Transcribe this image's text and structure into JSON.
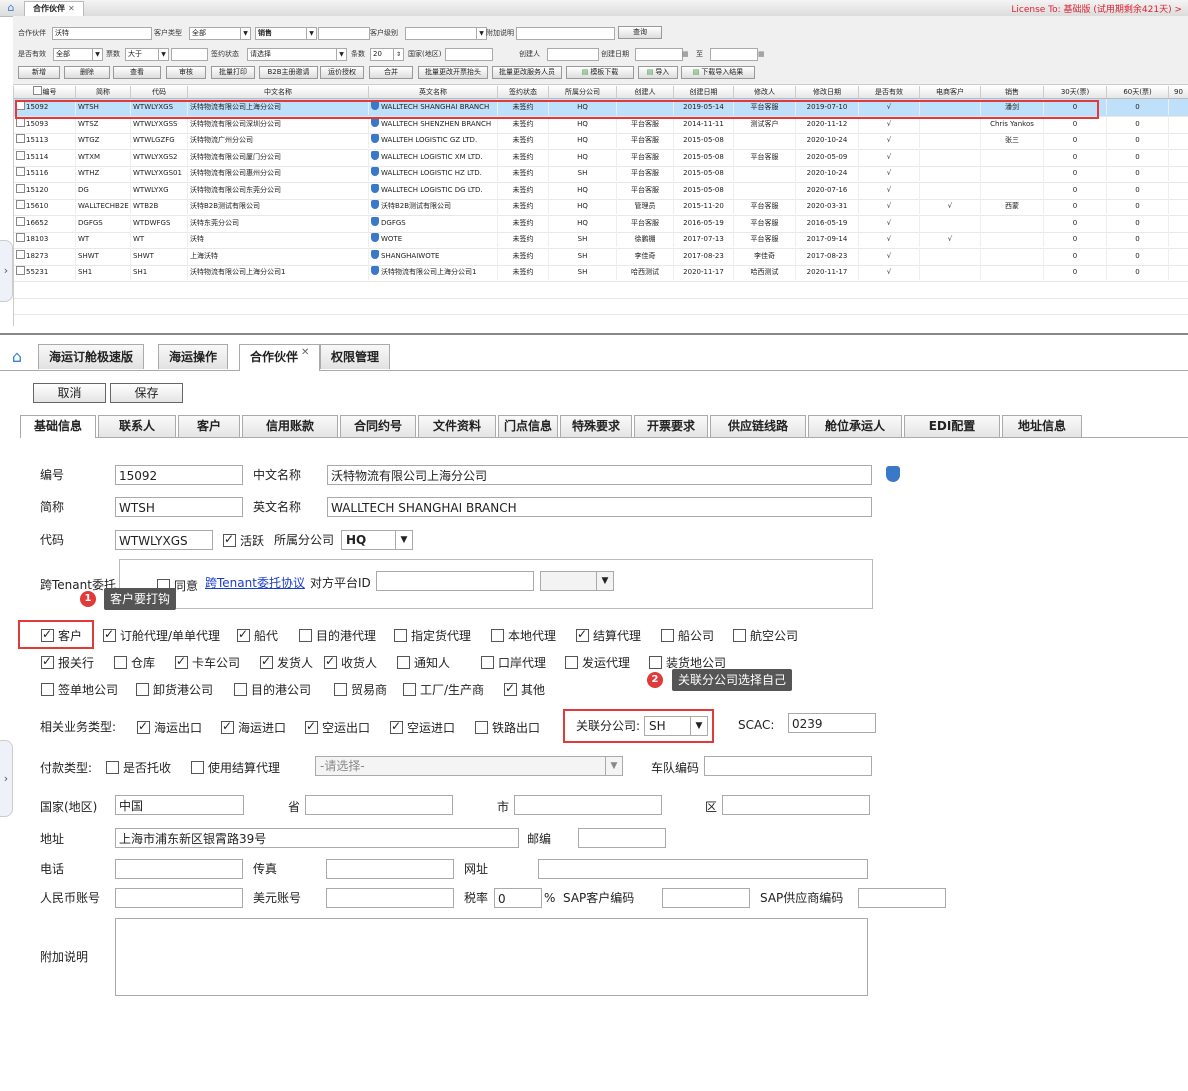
{
  "top": {
    "home_icon": "home-icon",
    "tab_label": "合作伙伴",
    "license": "License To: 基础版 (试用期剩余421天) >",
    "filters": {
      "partner_label": "合作伙伴",
      "partner_value": "沃特",
      "customer_type_label": "客户类型",
      "customer_type_value": "全部",
      "sales_value": "销售",
      "customer_level_label": "客户级别",
      "extra_label": "附加说明",
      "query_btn": "查询",
      "valid_label": "是否有效",
      "valid_value": "全部",
      "votes_label": "票数",
      "votes_op": "大于",
      "sign_status_label": "签约状态",
      "sign_status_value": "请选择",
      "rows_label": "条数",
      "rows_value": "20",
      "country_label": "国家(地区)",
      "creator_label": "创建人",
      "create_date_label": "创建日期",
      "to_label": "至"
    },
    "buttons": [
      "新增",
      "删除",
      "查看",
      "审核",
      "批量打印",
      "B2B主册邀请",
      "运价授权",
      "合并",
      "批量更改开票抬头",
      "批量更改服务人员",
      "模板下载",
      "导入",
      "下载导入结果"
    ],
    "columns": [
      "编号",
      "简称",
      "代码",
      "中文名称",
      "英文名称",
      "签约状态",
      "所属分公司",
      "创建人",
      "创建日期",
      "修改人",
      "修改日期",
      "是否有效",
      "电商客户",
      "销售",
      "30天(票)",
      "60天(票)",
      "90"
    ],
    "rows": [
      [
        "15092",
        "WTSH",
        "WTWLYXGS",
        "沃特物流有限公司上海分公司",
        "WALLTECH SHANGHAI BRANCH",
        "未签约",
        "HQ",
        "",
        "2019-05-14",
        "平台客服",
        "2019-07-10",
        "√",
        "",
        "潘剑",
        "0",
        "0"
      ],
      [
        "15093",
        "WTSZ",
        "WTWLYXGSS",
        "沃特物流有限公司深圳分公司",
        "WALLTECH SHENZHEN BRANCH",
        "未签约",
        "HQ",
        "平台客服",
        "2014-11-11",
        "测试客户",
        "2020-11-12",
        "√",
        "",
        "Chris Yankos",
        "0",
        "0"
      ],
      [
        "15113",
        "WTGZ",
        "WTWLGZFG",
        "沃特物流广州分公司",
        "WALLTEH LOGISTIC GZ LTD.",
        "未签约",
        "HQ",
        "平台客服",
        "2015-05-08",
        "",
        "2020-10-24",
        "√",
        "",
        "张三",
        "0",
        "0"
      ],
      [
        "15114",
        "WTXM",
        "WTWLYXGS2",
        "沃特物流有限公司厦门分公司",
        "WALLTECH LOGISTIC XM LTD.",
        "未签约",
        "HQ",
        "平台客服",
        "2015-05-08",
        "平台客服",
        "2020-05-09",
        "√",
        "",
        "",
        "0",
        "0"
      ],
      [
        "15116",
        "WTHZ",
        "WTWLYXGS01",
        "沃特物流有限公司惠州分公司",
        "WALLTECH LOGISTIC HZ LTD.",
        "未签约",
        "SH",
        "平台客服",
        "2015-05-08",
        "",
        "2020-10-24",
        "√",
        "",
        "",
        "0",
        "0"
      ],
      [
        "15120",
        "DG",
        "WTWLYXG",
        "沃特物流有限公司东莞分公司",
        "WALLTECH LOGISTIC DG LTD.",
        "未签约",
        "HQ",
        "平台客服",
        "2015-05-08",
        "",
        "2020-07-16",
        "√",
        "",
        "",
        "0",
        "0"
      ],
      [
        "15610",
        "WALLTECHB2E",
        "WTB2B",
        "沃特B2B测试有限公司",
        "沃特B2B测试有限公司",
        "未签约",
        "HQ",
        "管理员",
        "2015-11-20",
        "平台客服",
        "2020-03-31",
        "√",
        "√",
        "西蒙",
        "0",
        "0"
      ],
      [
        "16652",
        "DGFGS",
        "WTDWFGS",
        "沃特东莞分公司",
        "DGFGS",
        "未签约",
        "HQ",
        "平台客服",
        "2016-05-19",
        "平台客服",
        "2016-05-19",
        "√",
        "",
        "",
        "0",
        "0"
      ],
      [
        "18103",
        "WT",
        "WT",
        "沃特",
        "WOTE",
        "未签约",
        "SH",
        "徐鹏棚",
        "2017-07-13",
        "平台客服",
        "2017-09-14",
        "√",
        "√",
        "",
        "0",
        "0"
      ],
      [
        "18273",
        "SHWT",
        "SHWT",
        "上海沃特",
        "SHANGHAIWOTE",
        "未签约",
        "SH",
        "李佳奇",
        "2017-08-23",
        "李佳奇",
        "2017-08-23",
        "√",
        "",
        "",
        "0",
        "0"
      ],
      [
        "55231",
        "SH1",
        "SH1",
        "沃特物流有限公司上海分公司1",
        "沃特物流有限公司上海分公司1",
        "未签约",
        "SH",
        "哈西测试",
        "2020-11-17",
        "哈西测试",
        "2020-11-17",
        "√",
        "",
        "",
        "0",
        "0"
      ]
    ]
  },
  "bottom": {
    "home_icon": "home-icon",
    "tabs": [
      "海运订舱极速版",
      "海运操作",
      "合作伙伴",
      "权限管理"
    ],
    "cancel": "取消",
    "save": "保存",
    "subtabs": [
      "基础信息",
      "联系人",
      "客户",
      "信用账款",
      "合同约号",
      "文件资料",
      "门点信息",
      "特殊要求",
      "开票要求",
      "供应链线路",
      "舱位承运人",
      "EDI配置",
      "地址信息"
    ],
    "form": {
      "no_label": "编号",
      "no_value": "15092",
      "cn_name_label": "中文名称",
      "cn_name_value": "沃特物流有限公司上海分公司",
      "short_label": "简称",
      "short_value": "WTSH",
      "en_name_label": "英文名称",
      "en_name_value": "WALLTECH SHANGHAI BRANCH",
      "code_label": "代码",
      "code_value": "WTWLYXGS",
      "active_label": "活跃",
      "branch_label": "所属分公司",
      "branch_value": "HQ",
      "tenant_label": "跨Tenant委托",
      "agree_label": "同意",
      "tenant_link": "跨Tenant委托协议",
      "platform_id_label": "对方平台ID",
      "types_row1": [
        {
          "label": "客户",
          "on": true
        },
        {
          "label": "订舱代理/单单代理",
          "on": true
        },
        {
          "label": "船代",
          "on": true
        },
        {
          "label": "目的港代理",
          "on": false
        },
        {
          "label": "指定货代理",
          "on": false
        },
        {
          "label": "本地代理",
          "on": false
        },
        {
          "label": "结算代理",
          "on": true
        },
        {
          "label": "船公司",
          "on": false
        },
        {
          "label": "航空公司",
          "on": false
        }
      ],
      "types_row2": [
        {
          "label": "报关行",
          "on": true
        },
        {
          "label": "仓库",
          "on": false
        },
        {
          "label": "卡车公司",
          "on": true
        },
        {
          "label": "发货人",
          "on": true
        },
        {
          "label": "收货人",
          "on": true
        },
        {
          "label": "通知人",
          "on": false
        },
        {
          "label": "口岸代理",
          "on": false
        },
        {
          "label": "发运代理",
          "on": false
        },
        {
          "label": "装货地公司",
          "on": false
        }
      ],
      "types_row3": [
        {
          "label": "签单地公司",
          "on": false
        },
        {
          "label": "卸货港公司",
          "on": false
        },
        {
          "label": "目的港公司",
          "on": false
        },
        {
          "label": "贸易商",
          "on": false
        },
        {
          "label": "工厂/生产商",
          "on": false
        },
        {
          "label": "其他",
          "on": true
        }
      ],
      "biz_label": "相关业务类型:",
      "biz_types": [
        {
          "label": "海运出口",
          "on": true
        },
        {
          "label": "海运进口",
          "on": true
        },
        {
          "label": "空运出口",
          "on": true
        },
        {
          "label": "空运进口",
          "on": true
        },
        {
          "label": "铁路出口",
          "on": false
        }
      ],
      "rel_branch_label": "关联分公司:",
      "rel_branch_value": "SH",
      "scac_label": "SCAC:",
      "scac_value": "0239",
      "pay_label": "付款类型:",
      "pay_opts": [
        {
          "label": "是否托收",
          "on": false
        },
        {
          "label": "使用结算代理",
          "on": false
        }
      ],
      "pay_select_placeholder": "-请选择-",
      "fleet_label": "车队编码",
      "country_label": "国家(地区)",
      "country_value": "中国",
      "province_label": "省",
      "city_label": "市",
      "district_label": "区",
      "address_label": "地址",
      "address_value": "上海市浦东新区银霄路39号",
      "zip_label": "邮编",
      "phone_label": "电话",
      "fax_label": "传真",
      "website_label": "网址",
      "rmb_label": "人民币账号",
      "usd_label": "美元账号",
      "tax_label": "税率",
      "tax_value": "0",
      "pct": "%",
      "sap_cust_label": "SAP客户编码",
      "sap_vendor_label": "SAP供应商编码",
      "remark_label": "附加说明"
    },
    "tip1": {
      "num": "1",
      "text": "客户要打钩"
    },
    "tip2": {
      "num": "2",
      "text": "关联分公司选择自己"
    }
  },
  "colors": {
    "highlight": "#e03a3a",
    "selected_row": "#bfe0fa",
    "license": "#d22233"
  }
}
